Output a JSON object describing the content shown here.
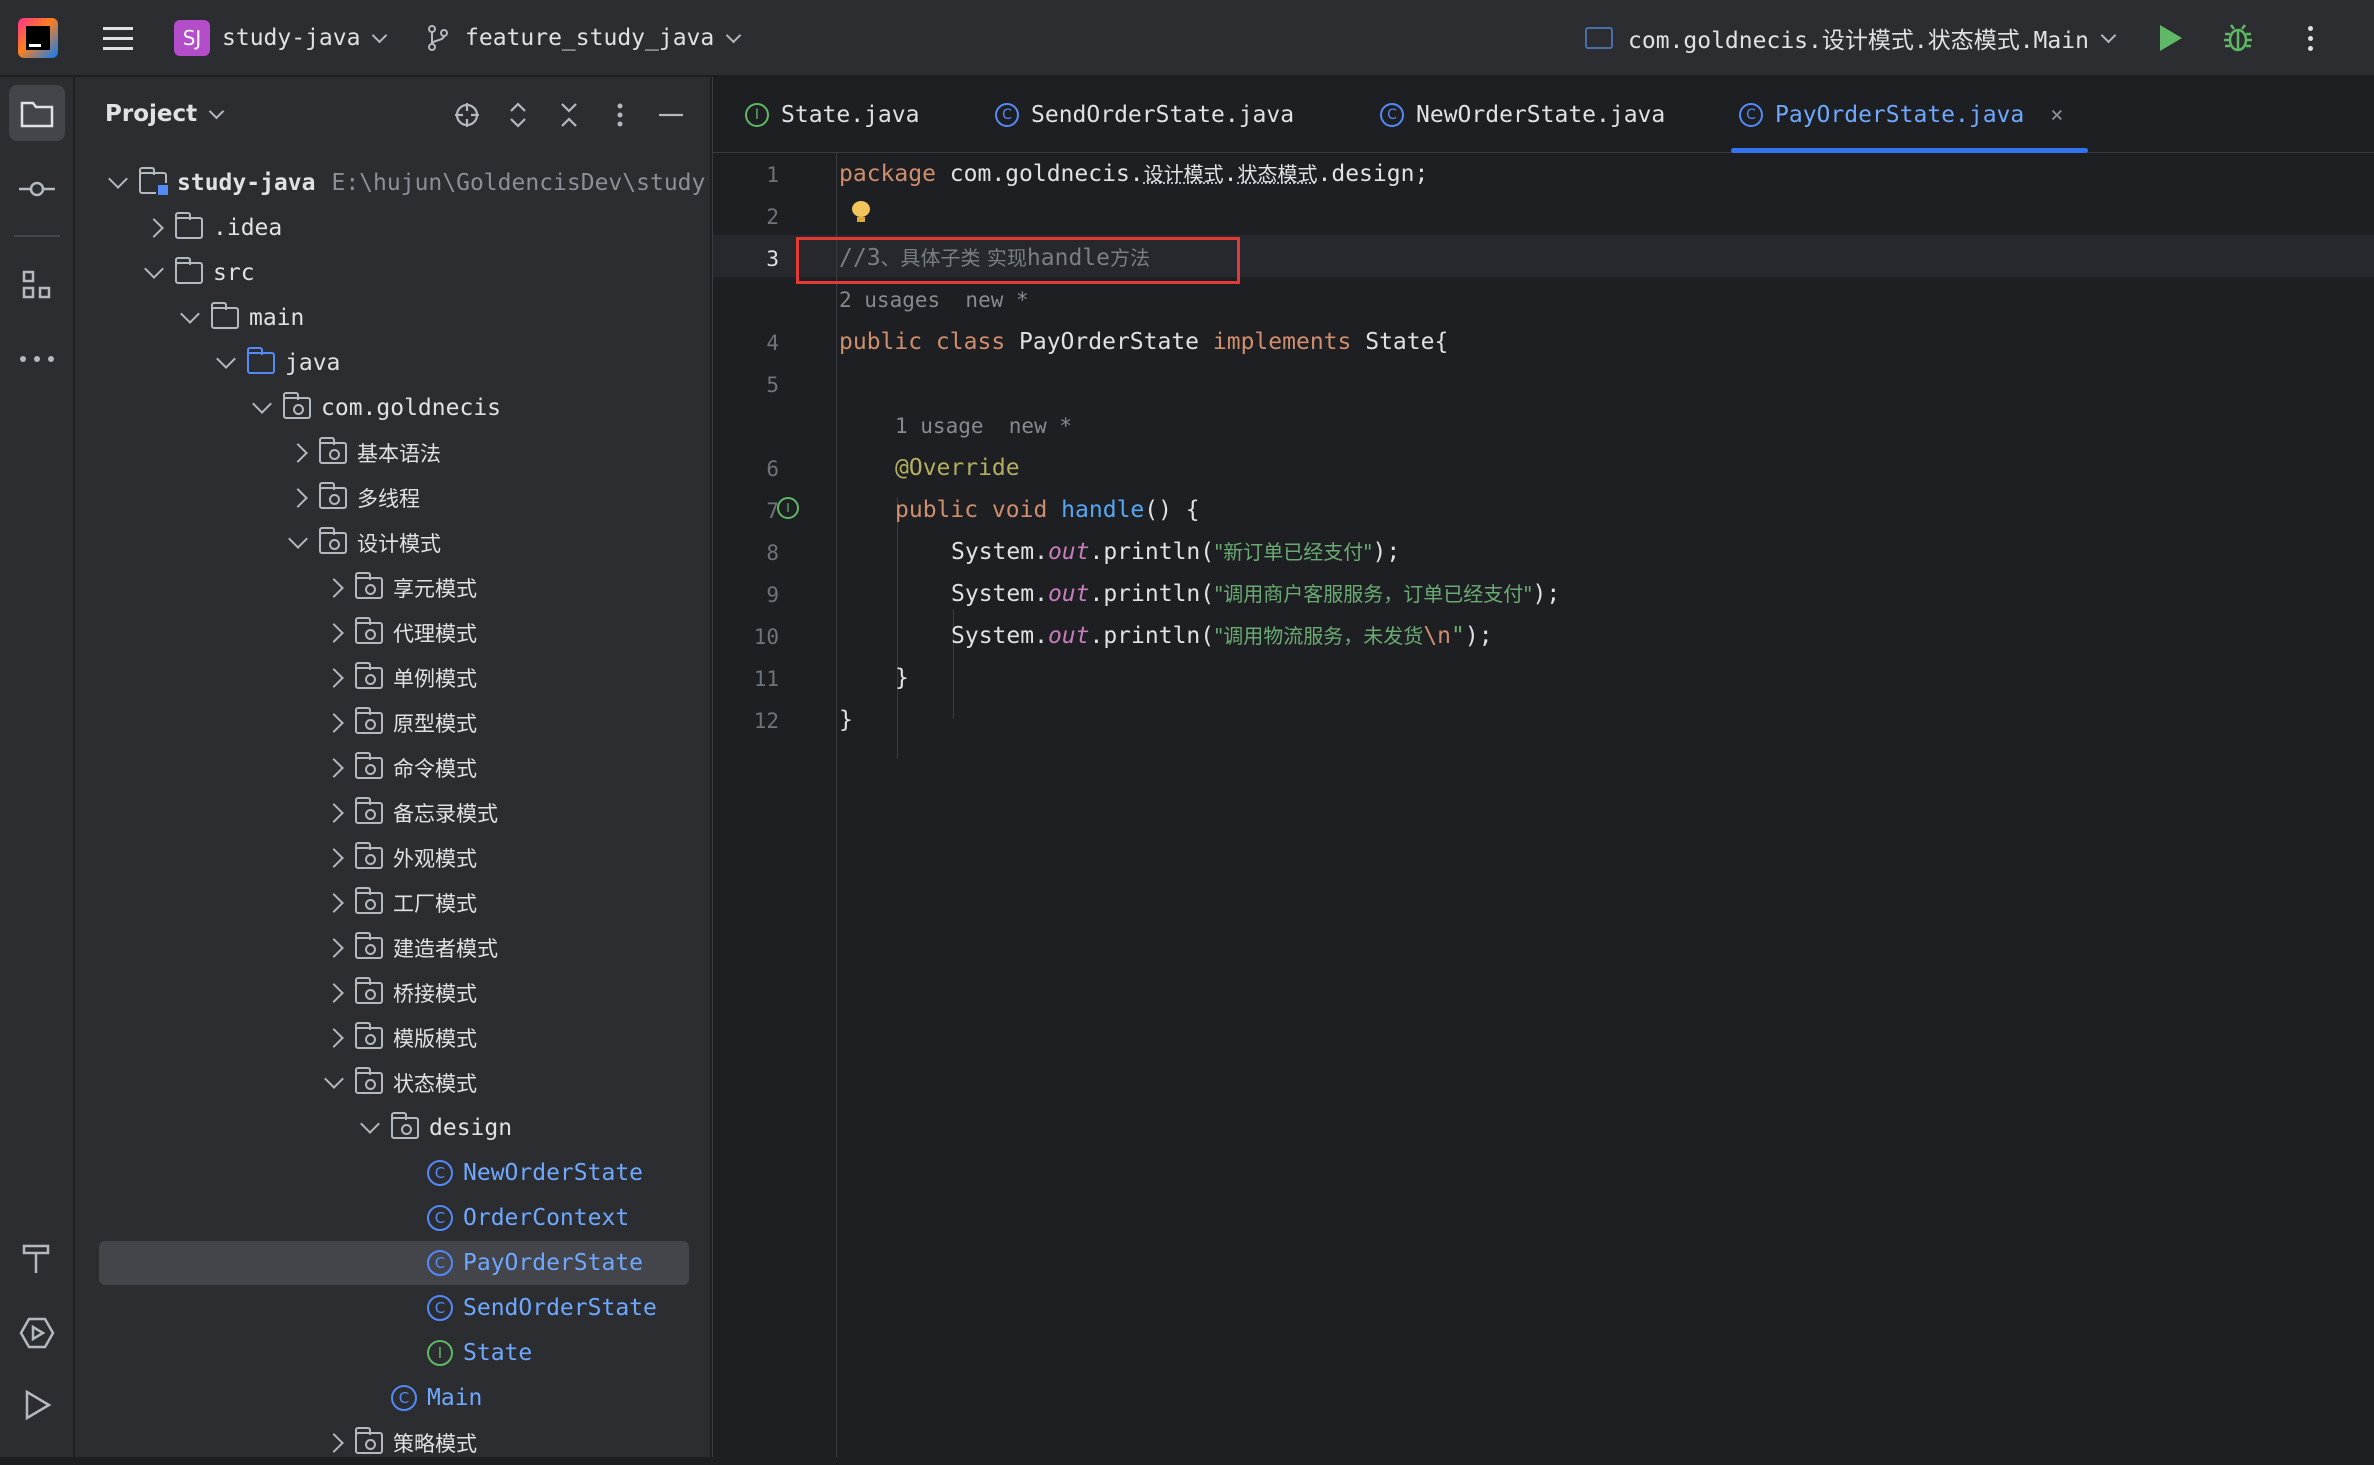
{
  "titlebar": {
    "project_badge": "SJ",
    "project_name": "study-java",
    "branch": "feature_study_java",
    "run_config": "com.goldnecis.设计模式.状态模式.Main"
  },
  "project_panel": {
    "title": "Project",
    "tree": [
      {
        "label": "study-java",
        "extra": "E:\\hujun\\GoldencisDev\\study",
        "type": "module",
        "depth": 0,
        "state": "open"
      },
      {
        "label": ".idea",
        "type": "folder",
        "depth": 1,
        "state": "closed"
      },
      {
        "label": "src",
        "type": "folder",
        "depth": 1,
        "state": "open"
      },
      {
        "label": "main",
        "type": "folder",
        "depth": 2,
        "state": "open"
      },
      {
        "label": "java",
        "type": "source",
        "depth": 3,
        "state": "open"
      },
      {
        "label": "com.goldnecis",
        "type": "package",
        "depth": 4,
        "state": "open"
      },
      {
        "label": "基本语法",
        "type": "package",
        "depth": 5,
        "state": "closed"
      },
      {
        "label": "多线程",
        "type": "package",
        "depth": 5,
        "state": "closed"
      },
      {
        "label": "设计模式",
        "type": "package",
        "depth": 5,
        "state": "open"
      },
      {
        "label": "享元模式",
        "type": "package",
        "depth": 6,
        "state": "closed"
      },
      {
        "label": "代理模式",
        "type": "package",
        "depth": 6,
        "state": "closed"
      },
      {
        "label": "单例模式",
        "type": "package",
        "depth": 6,
        "state": "closed"
      },
      {
        "label": "原型模式",
        "type": "package",
        "depth": 6,
        "state": "closed"
      },
      {
        "label": "命令模式",
        "type": "package",
        "depth": 6,
        "state": "closed"
      },
      {
        "label": "备忘录模式",
        "type": "package",
        "depth": 6,
        "state": "closed"
      },
      {
        "label": "外观模式",
        "type": "package",
        "depth": 6,
        "state": "closed"
      },
      {
        "label": "工厂模式",
        "type": "package",
        "depth": 6,
        "state": "closed"
      },
      {
        "label": "建造者模式",
        "type": "package",
        "depth": 6,
        "state": "closed"
      },
      {
        "label": "桥接模式",
        "type": "package",
        "depth": 6,
        "state": "closed"
      },
      {
        "label": "模版模式",
        "type": "package",
        "depth": 6,
        "state": "closed"
      },
      {
        "label": "状态模式",
        "type": "package",
        "depth": 6,
        "state": "open"
      },
      {
        "label": "design",
        "type": "package",
        "depth": 7,
        "state": "open"
      },
      {
        "label": "NewOrderState",
        "type": "class",
        "depth": 8,
        "state": "none"
      },
      {
        "label": "OrderContext",
        "type": "class",
        "depth": 8,
        "state": "none"
      },
      {
        "label": "PayOrderState",
        "type": "class",
        "depth": 8,
        "state": "none",
        "selected": true
      },
      {
        "label": "SendOrderState",
        "type": "class",
        "depth": 8,
        "state": "none"
      },
      {
        "label": "State",
        "type": "interface",
        "depth": 8,
        "state": "none"
      },
      {
        "label": "Main",
        "type": "class",
        "depth": 7,
        "state": "none"
      },
      {
        "label": "策略模式",
        "type": "package",
        "depth": 6,
        "state": "closed"
      }
    ]
  },
  "tabs": [
    {
      "label": "State.java",
      "kind": "interface"
    },
    {
      "label": "SendOrderState.java",
      "kind": "class"
    },
    {
      "label": "NewOrderState.java",
      "kind": "class"
    },
    {
      "label": "PayOrderState.java",
      "kind": "class",
      "active": true,
      "close": "×"
    }
  ],
  "editor": {
    "line_numbers": [
      "1",
      "2",
      "3",
      "4",
      "5",
      "6",
      "7",
      "8",
      "9",
      "10",
      "11",
      "12"
    ],
    "current_line": "3",
    "l1": {
      "kw": "package",
      "pre": " com.goldnecis.",
      "p1": "设计模式",
      "dot": ".",
      "p2": "状态模式",
      "post": ".design;"
    },
    "l3": {
      "slash": "//3",
      "text": "、具体子类 实现",
      "mid": "handle",
      "end": "方法"
    },
    "hint1": "2 usages  new *",
    "l4": {
      "k1": "public class",
      "name": " PayOrderState ",
      "k2": "implements",
      "rest": " State{"
    },
    "hint2": "1 usage  new *",
    "l6": "@Override",
    "l7": {
      "k": "public void",
      "fn": " handle",
      "rest": "() {"
    },
    "println": [
      {
        "pre": "System.",
        "out": "out",
        "mid": ".println(",
        "s": "\"新订单已经支付\"",
        "esc": "",
        "end": ");"
      },
      {
        "pre": "System.",
        "out": "out",
        "mid": ".println(",
        "s": "\"调用商户客服服务，订单已经支付\"",
        "esc": "",
        "end": ");"
      },
      {
        "pre": "System.",
        "out": "out",
        "mid": ".println(",
        "s": "\"调用物流服务，未发货",
        "esc": "\\n",
        "end": "\");"
      }
    ],
    "l11": "}",
    "l12": "}"
  }
}
